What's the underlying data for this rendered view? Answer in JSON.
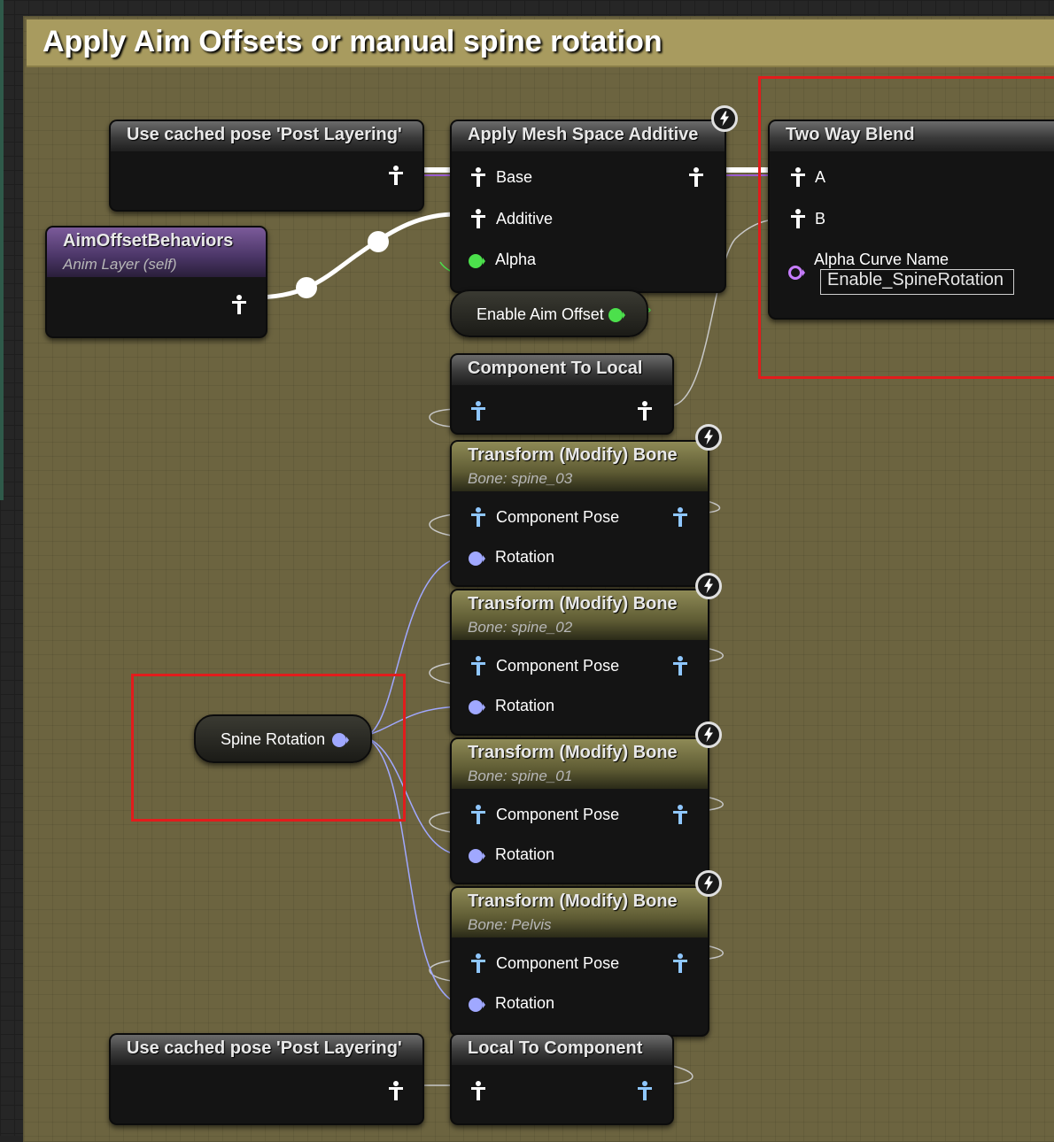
{
  "comment": {
    "title": "Apply Aim Offsets or manual spine rotation"
  },
  "nodes": {
    "cached_pose_top": {
      "title": "Use cached pose 'Post Layering'"
    },
    "aim_offset_behaviors": {
      "title": "AimOffsetBehaviors",
      "subtitle": "Anim Layer (self)"
    },
    "mesh_space_additive": {
      "title": "Apply Mesh Space Additive",
      "pins": {
        "base": "Base",
        "additive": "Additive",
        "alpha": "Alpha"
      }
    },
    "enable_aim_offset": {
      "label": "Enable Aim Offset"
    },
    "two_way_blend": {
      "title": "Two Way Blend",
      "pins": {
        "a": "A",
        "b": "B",
        "alpha_curve_name": "Alpha Curve Name"
      },
      "curve_value": "Enable_SpineRotation"
    },
    "component_to_local": {
      "title": "Component To Local"
    },
    "transform_bones": [
      {
        "title": "Transform (Modify) Bone",
        "bone": "Bone: spine_03",
        "component_pose": "Component Pose",
        "rotation": "Rotation"
      },
      {
        "title": "Transform (Modify) Bone",
        "bone": "Bone: spine_02",
        "component_pose": "Component Pose",
        "rotation": "Rotation"
      },
      {
        "title": "Transform (Modify) Bone",
        "bone": "Bone: spine_01",
        "component_pose": "Component Pose",
        "rotation": "Rotation"
      },
      {
        "title": "Transform (Modify) Bone",
        "bone": "Bone: Pelvis",
        "component_pose": "Component Pose",
        "rotation": "Rotation"
      }
    ],
    "spine_rotation": {
      "label": "Spine Rotation"
    },
    "cached_pose_bottom": {
      "title": "Use cached pose 'Post Layering'"
    },
    "local_to_component": {
      "title": "Local To Component"
    }
  },
  "colors": {
    "pose_pin_white": "#ffffff",
    "pose_pin_blue": "#8fc7ff",
    "bool_pin": "#4ce04c",
    "rotator_pin": "#a0a8ff",
    "name_pin": "#c77dff",
    "highlight_box": "#e21c1c",
    "comment_bg": "#6c6440"
  },
  "icons": {
    "pose": "pose-person-icon",
    "exec": "lightning-icon",
    "bool": "bool-pin-icon",
    "rotator": "rotator-pin-icon",
    "name": "name-pin-icon"
  }
}
